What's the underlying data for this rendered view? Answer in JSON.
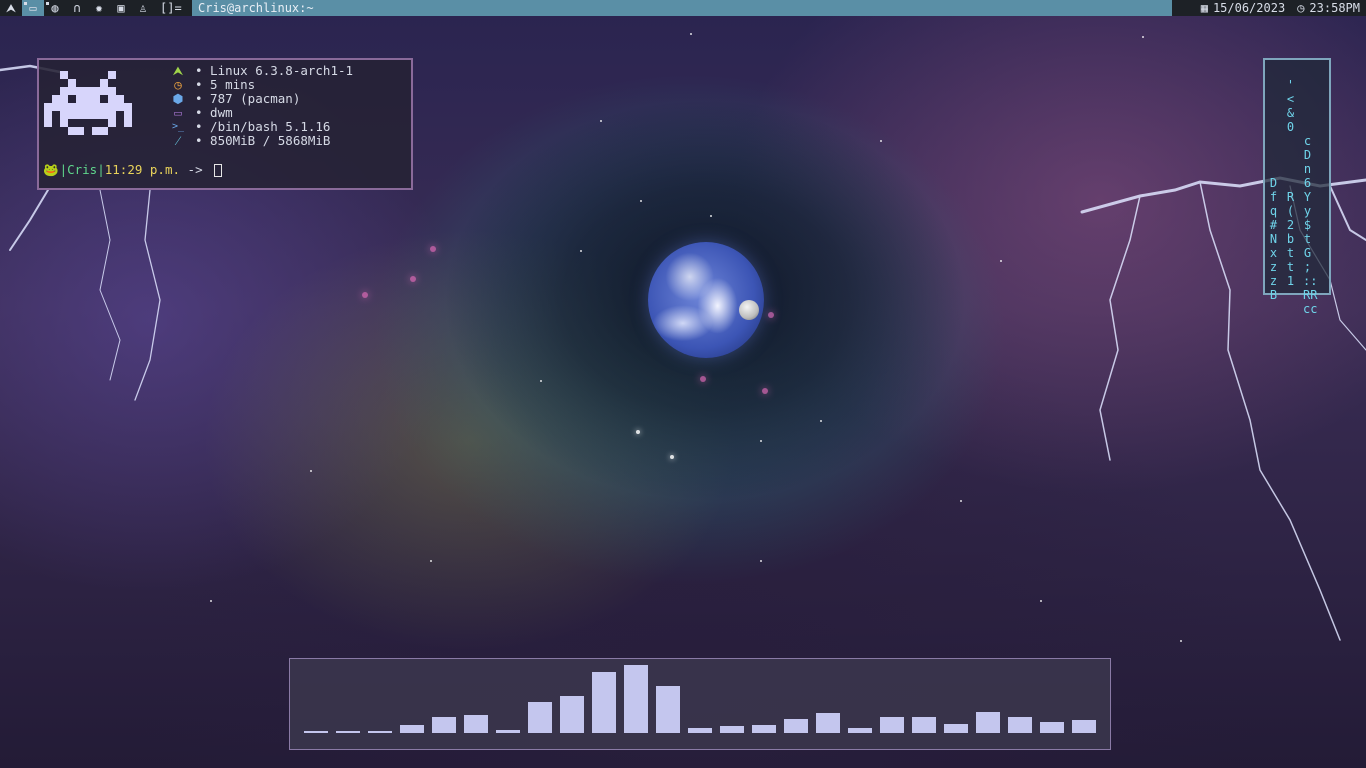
{
  "topbar": {
    "tags": [
      {
        "icon": "arch-icon",
        "glyph": "⮝",
        "active": false
      },
      {
        "icon": "terminal-icon",
        "glyph": "▭",
        "active": true
      },
      {
        "icon": "firefox-icon",
        "glyph": "◍",
        "active": false
      },
      {
        "icon": "headphones-icon",
        "glyph": "∩",
        "active": false
      },
      {
        "icon": "gear-icon",
        "glyph": "✹",
        "active": false
      },
      {
        "icon": "image-icon",
        "glyph": "▣",
        "active": false
      },
      {
        "icon": "linux-icon",
        "glyph": "♙",
        "active": false
      }
    ],
    "layout_symbol": "[]=",
    "window_title": "Cris@archlinux:~",
    "date": "15/06/2023",
    "time": "23:58PM"
  },
  "terminal": {
    "info": [
      {
        "icon": "arch-icon",
        "glyph": "⮝",
        "color": "#9fd44a",
        "text": "• Linux 6.3.8-arch1-1"
      },
      {
        "icon": "clock-icon",
        "glyph": "◷",
        "color": "#e8a040",
        "text": "• 5 mins"
      },
      {
        "icon": "package-icon",
        "glyph": "⬢",
        "color": "#6aa8e8",
        "text": "• 787 (pacman)"
      },
      {
        "icon": "window-icon",
        "glyph": "▭",
        "color": "#a070c8",
        "text": "• dwm"
      },
      {
        "icon": "shell-icon",
        "glyph": ">_",
        "color": "#6aa8e8",
        "text": "• /bin/bash 5.1.16"
      },
      {
        "icon": "memory-icon",
        "glyph": "⁄",
        "color": "#6ad0e8",
        "text": "• 850MiB / 5868MiB"
      }
    ],
    "prompt": {
      "frog": "🐸",
      "pipe1": "|",
      "user": "Cris",
      "pipe2": "|",
      "time": "11:29 p.m.",
      "arrow": " -> "
    }
  },
  "matrix": {
    "columns": [
      [
        "",
        "",
        "",
        "",
        "D",
        "f",
        "q",
        "#",
        "N",
        "x",
        "z",
        "z",
        "B"
      ],
      [
        "'",
        "<",
        "&",
        "0",
        "",
        "",
        "",
        "",
        "R",
        "(",
        "2",
        "b",
        "t",
        "t",
        "1"
      ],
      [
        "",
        "",
        "c",
        "D",
        "n",
        "6",
        "Y",
        "y",
        "$",
        "t",
        "G",
        ";",
        "::",
        "RR",
        "cc"
      ]
    ]
  },
  "visualizer": {
    "levels": [
      0.02,
      0.02,
      0.02,
      0.12,
      0.24,
      0.26,
      0.05,
      0.46,
      0.54,
      0.89,
      1.0,
      0.69,
      0.08,
      0.1,
      0.12,
      0.2,
      0.3,
      0.07,
      0.23,
      0.24,
      0.13,
      0.31,
      0.23,
      0.16,
      0.19
    ],
    "color": "#c4c6ee"
  }
}
